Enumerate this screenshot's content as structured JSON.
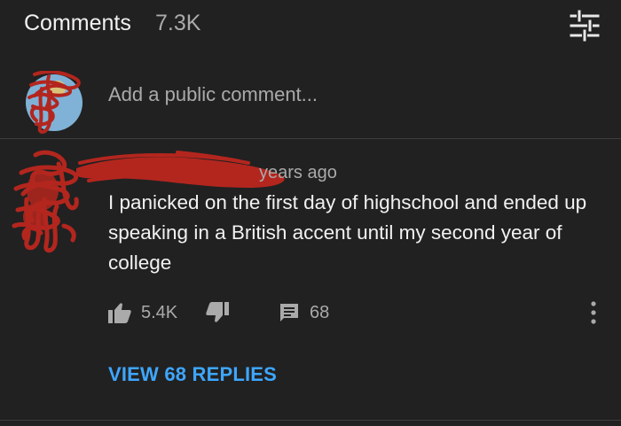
{
  "header": {
    "title": "Comments",
    "count": "7.3K",
    "filter_icon": "sort-filter-icon"
  },
  "add_comment": {
    "placeholder": "Add a public comment..."
  },
  "comment": {
    "author": "",
    "age": "years ago",
    "text": "I panicked on the first day of highschool and ended up speaking in a British accent until my second year of college",
    "likes": "5.4K",
    "reply_count": "68",
    "view_replies_label": "VIEW 68 REPLIES"
  },
  "colors": {
    "background": "#212121",
    "primary_text": "#f1f1f1",
    "secondary_text": "#aaaaaa",
    "link": "#3ea6ff",
    "scribble": "#b3261e"
  }
}
